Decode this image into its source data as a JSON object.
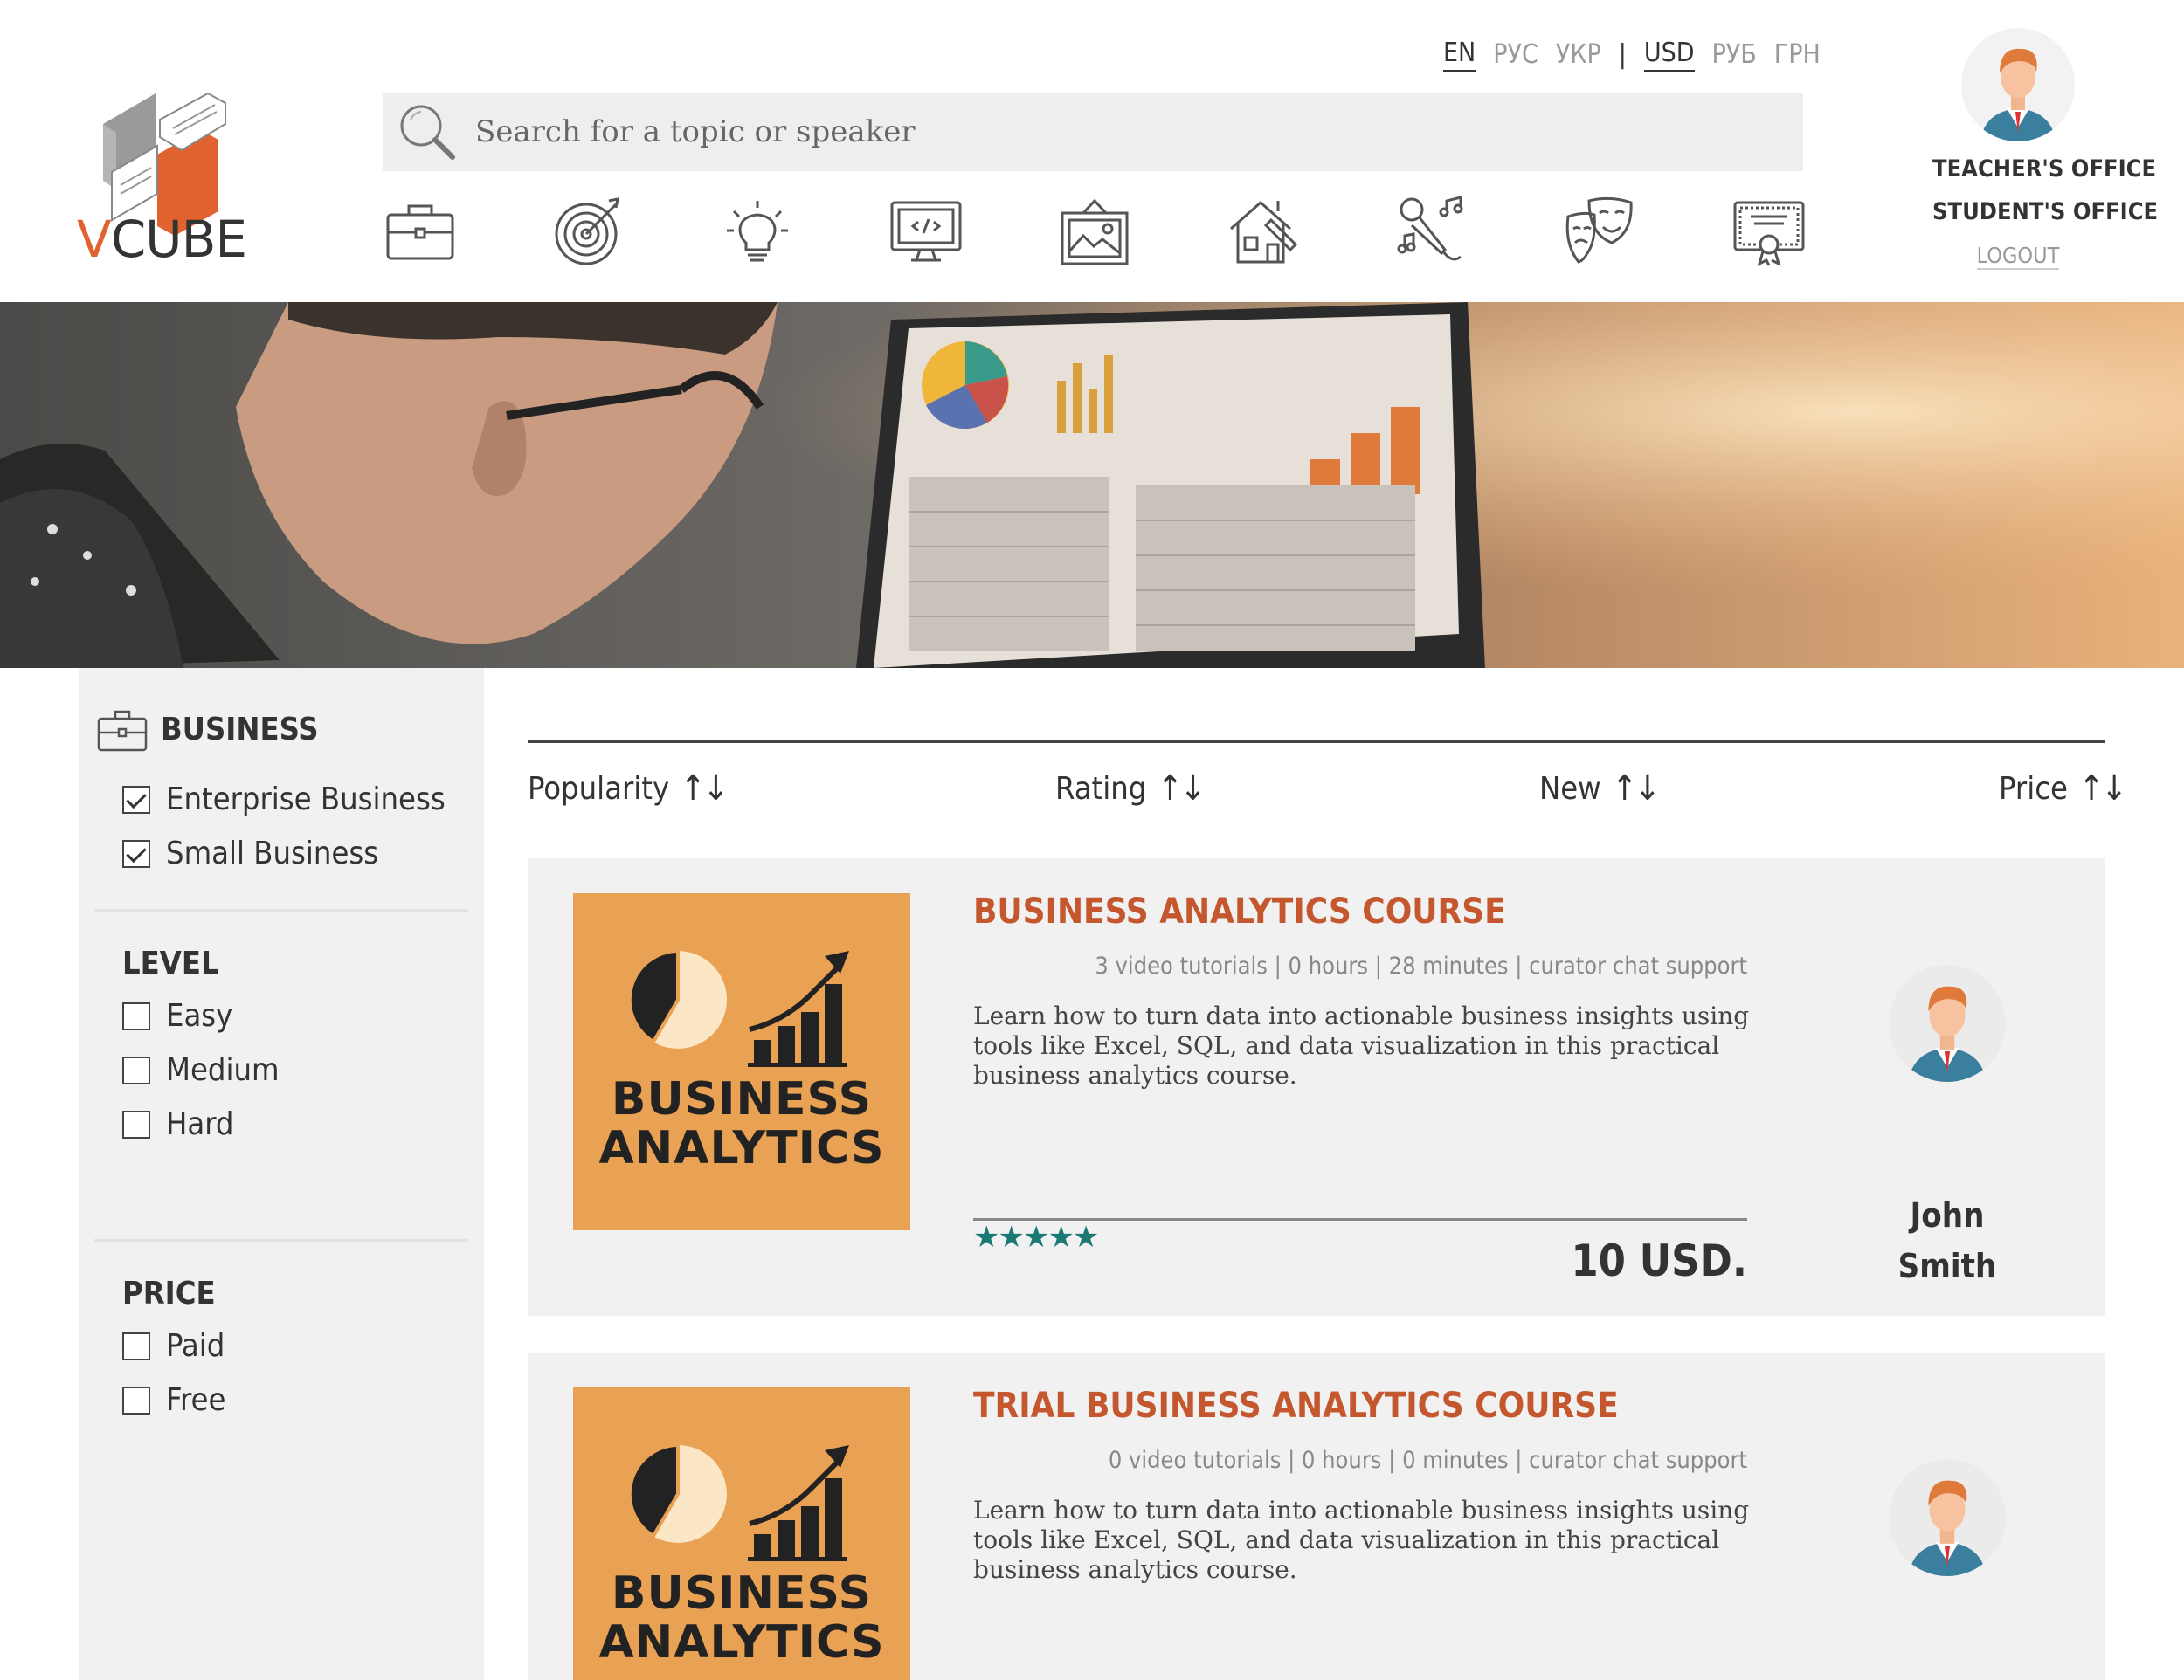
{
  "brand": {
    "logo_v": "V",
    "logo_rest": "CUBE",
    "accent": "#e0622e"
  },
  "languages": [
    "EN",
    "РУС",
    "УКР"
  ],
  "currencies": [
    "USD",
    "РУБ",
    "ГРН"
  ],
  "language_active": "EN",
  "currency_active": "USD",
  "search": {
    "placeholder": "Search for a topic or speaker"
  },
  "categories": [
    "briefcase-icon",
    "target-icon",
    "lightbulb-icon",
    "code-monitor-icon",
    "picture-frame-icon",
    "house-design-icon",
    "microphone-music-icon",
    "theater-masks-icon",
    "certificate-icon"
  ],
  "account": {
    "teacher": "TEACHER'S OFFICE",
    "student": "STUDENT'S OFFICE",
    "logout": "LOGOUT"
  },
  "filters": {
    "business": {
      "heading": "BUSINESS",
      "options": [
        {
          "label": "Enterprise Business",
          "checked": true
        },
        {
          "label": "Small Business",
          "checked": true
        }
      ]
    },
    "level": {
      "heading": "LEVEL",
      "options": [
        {
          "label": "Easy",
          "checked": false
        },
        {
          "label": "Medium",
          "checked": false
        },
        {
          "label": "Hard",
          "checked": false
        }
      ]
    },
    "price": {
      "heading": "PRICE",
      "options": [
        {
          "label": "Paid",
          "checked": false
        },
        {
          "label": "Free",
          "checked": false
        }
      ]
    }
  },
  "sort": {
    "arrows": "↑↓",
    "items": [
      "Popularity",
      "Rating",
      "New",
      "Price"
    ]
  },
  "courses": [
    {
      "title": "BUSINESS ANALYTICS COURSE",
      "meta": "3 video tutorials | 0 hours | 28 minutes | curator chat support",
      "description": "Learn how to turn data into actionable business insights using tools like Excel, SQL, and data visualization in this practical business analytics course.",
      "thumb_line1": "BUSINESS",
      "thumb_line2": "ANALYTICS",
      "rating": 5,
      "stars": "★★★★★",
      "price": "10 USD.",
      "teacher_first": "John",
      "teacher_last": "Smith"
    },
    {
      "title": "TRIAL BUSINESS ANALYTICS COURSE",
      "meta": "0 video tutorials | 0 hours | 0 minutes | curator chat support",
      "description": "Learn how to turn data into actionable business insights using tools like Excel, SQL, and data visualization in this practical business analytics course.",
      "thumb_line1": "BUSINESS",
      "thumb_line2": "ANALYTICS"
    }
  ]
}
